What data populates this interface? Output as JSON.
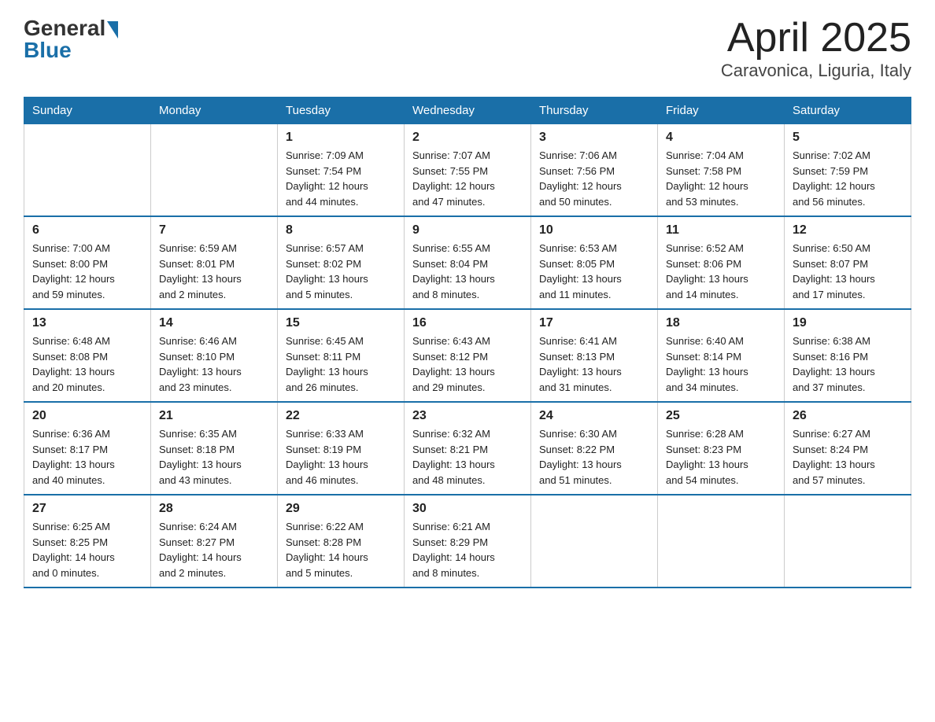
{
  "logo": {
    "general": "General",
    "blue": "Blue"
  },
  "title": "April 2025",
  "subtitle": "Caravonica, Liguria, Italy",
  "headers": [
    "Sunday",
    "Monday",
    "Tuesday",
    "Wednesday",
    "Thursday",
    "Friday",
    "Saturday"
  ],
  "weeks": [
    [
      {
        "day": "",
        "info": ""
      },
      {
        "day": "",
        "info": ""
      },
      {
        "day": "1",
        "info": "Sunrise: 7:09 AM\nSunset: 7:54 PM\nDaylight: 12 hours\nand 44 minutes."
      },
      {
        "day": "2",
        "info": "Sunrise: 7:07 AM\nSunset: 7:55 PM\nDaylight: 12 hours\nand 47 minutes."
      },
      {
        "day": "3",
        "info": "Sunrise: 7:06 AM\nSunset: 7:56 PM\nDaylight: 12 hours\nand 50 minutes."
      },
      {
        "day": "4",
        "info": "Sunrise: 7:04 AM\nSunset: 7:58 PM\nDaylight: 12 hours\nand 53 minutes."
      },
      {
        "day": "5",
        "info": "Sunrise: 7:02 AM\nSunset: 7:59 PM\nDaylight: 12 hours\nand 56 minutes."
      }
    ],
    [
      {
        "day": "6",
        "info": "Sunrise: 7:00 AM\nSunset: 8:00 PM\nDaylight: 12 hours\nand 59 minutes."
      },
      {
        "day": "7",
        "info": "Sunrise: 6:59 AM\nSunset: 8:01 PM\nDaylight: 13 hours\nand 2 minutes."
      },
      {
        "day": "8",
        "info": "Sunrise: 6:57 AM\nSunset: 8:02 PM\nDaylight: 13 hours\nand 5 minutes."
      },
      {
        "day": "9",
        "info": "Sunrise: 6:55 AM\nSunset: 8:04 PM\nDaylight: 13 hours\nand 8 minutes."
      },
      {
        "day": "10",
        "info": "Sunrise: 6:53 AM\nSunset: 8:05 PM\nDaylight: 13 hours\nand 11 minutes."
      },
      {
        "day": "11",
        "info": "Sunrise: 6:52 AM\nSunset: 8:06 PM\nDaylight: 13 hours\nand 14 minutes."
      },
      {
        "day": "12",
        "info": "Sunrise: 6:50 AM\nSunset: 8:07 PM\nDaylight: 13 hours\nand 17 minutes."
      }
    ],
    [
      {
        "day": "13",
        "info": "Sunrise: 6:48 AM\nSunset: 8:08 PM\nDaylight: 13 hours\nand 20 minutes."
      },
      {
        "day": "14",
        "info": "Sunrise: 6:46 AM\nSunset: 8:10 PM\nDaylight: 13 hours\nand 23 minutes."
      },
      {
        "day": "15",
        "info": "Sunrise: 6:45 AM\nSunset: 8:11 PM\nDaylight: 13 hours\nand 26 minutes."
      },
      {
        "day": "16",
        "info": "Sunrise: 6:43 AM\nSunset: 8:12 PM\nDaylight: 13 hours\nand 29 minutes."
      },
      {
        "day": "17",
        "info": "Sunrise: 6:41 AM\nSunset: 8:13 PM\nDaylight: 13 hours\nand 31 minutes."
      },
      {
        "day": "18",
        "info": "Sunrise: 6:40 AM\nSunset: 8:14 PM\nDaylight: 13 hours\nand 34 minutes."
      },
      {
        "day": "19",
        "info": "Sunrise: 6:38 AM\nSunset: 8:16 PM\nDaylight: 13 hours\nand 37 minutes."
      }
    ],
    [
      {
        "day": "20",
        "info": "Sunrise: 6:36 AM\nSunset: 8:17 PM\nDaylight: 13 hours\nand 40 minutes."
      },
      {
        "day": "21",
        "info": "Sunrise: 6:35 AM\nSunset: 8:18 PM\nDaylight: 13 hours\nand 43 minutes."
      },
      {
        "day": "22",
        "info": "Sunrise: 6:33 AM\nSunset: 8:19 PM\nDaylight: 13 hours\nand 46 minutes."
      },
      {
        "day": "23",
        "info": "Sunrise: 6:32 AM\nSunset: 8:21 PM\nDaylight: 13 hours\nand 48 minutes."
      },
      {
        "day": "24",
        "info": "Sunrise: 6:30 AM\nSunset: 8:22 PM\nDaylight: 13 hours\nand 51 minutes."
      },
      {
        "day": "25",
        "info": "Sunrise: 6:28 AM\nSunset: 8:23 PM\nDaylight: 13 hours\nand 54 minutes."
      },
      {
        "day": "26",
        "info": "Sunrise: 6:27 AM\nSunset: 8:24 PM\nDaylight: 13 hours\nand 57 minutes."
      }
    ],
    [
      {
        "day": "27",
        "info": "Sunrise: 6:25 AM\nSunset: 8:25 PM\nDaylight: 14 hours\nand 0 minutes."
      },
      {
        "day": "28",
        "info": "Sunrise: 6:24 AM\nSunset: 8:27 PM\nDaylight: 14 hours\nand 2 minutes."
      },
      {
        "day": "29",
        "info": "Sunrise: 6:22 AM\nSunset: 8:28 PM\nDaylight: 14 hours\nand 5 minutes."
      },
      {
        "day": "30",
        "info": "Sunrise: 6:21 AM\nSunset: 8:29 PM\nDaylight: 14 hours\nand 8 minutes."
      },
      {
        "day": "",
        "info": ""
      },
      {
        "day": "",
        "info": ""
      },
      {
        "day": "",
        "info": ""
      }
    ]
  ]
}
